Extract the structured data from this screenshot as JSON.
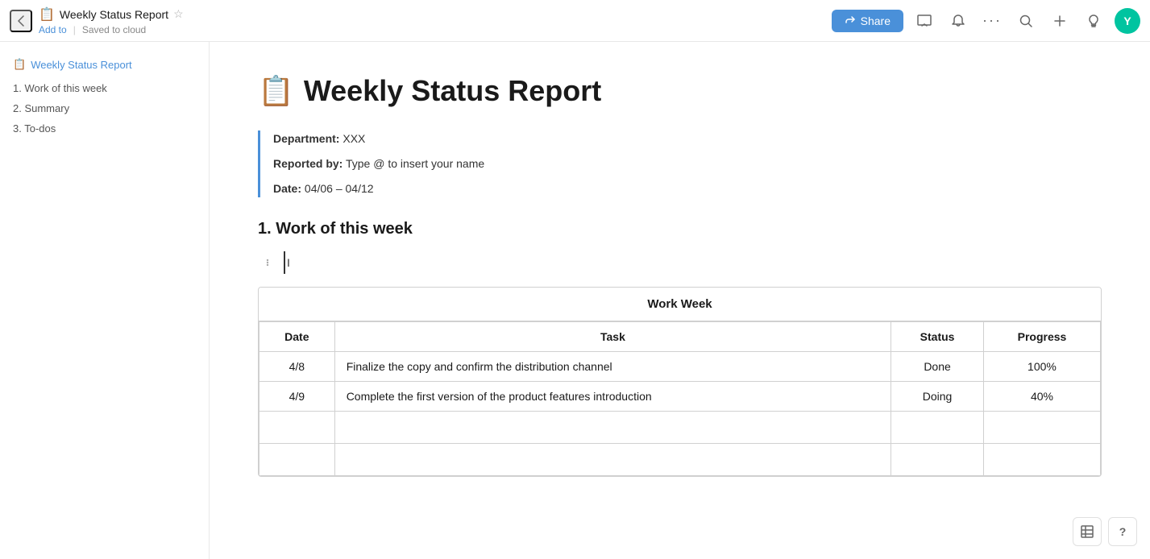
{
  "topbar": {
    "back_icon": "‹",
    "doc_icon": "📋",
    "doc_title": "Weekly Status Report",
    "star_icon": "☆",
    "add_to": "Add to",
    "separator": "|",
    "saved_status": "Saved to cloud",
    "share_label": "Share",
    "link_icon": "🔗",
    "present_icon": "⬜",
    "bell_icon": "🔔",
    "more_icon": "···",
    "search_icon": "🔍",
    "plus_icon": "+",
    "bulb_icon": "💡",
    "avatar_label": "Y"
  },
  "sidebar": {
    "doc_icon": "📋",
    "doc_link": "Weekly Status Report",
    "nav_items": [
      {
        "label": "1. Work of this week"
      },
      {
        "label": "2. Summary"
      },
      {
        "label": "3. To-dos"
      }
    ]
  },
  "main": {
    "heading_icon": "📋",
    "heading": "Weekly Status Report",
    "info": {
      "department_label": "Department:",
      "department_value": "XXX",
      "reported_by_label": "Reported by:",
      "reported_by_value": "Type @ to insert your name",
      "date_label": "Date:",
      "date_value": "04/06 – 04/12"
    },
    "section1_heading": "1. Work of this week",
    "table": {
      "title": "Work Week",
      "columns": [
        "Date",
        "Task",
        "Status",
        "Progress"
      ],
      "rows": [
        {
          "date": "4/8",
          "task": "Finalize the copy and confirm the distribution channel",
          "status": "Done",
          "progress": "100%"
        },
        {
          "date": "4/9",
          "task": "Complete the first version of the product features introduction",
          "status": "Doing",
          "progress": "40%"
        },
        {
          "date": "",
          "task": "",
          "status": "",
          "progress": ""
        },
        {
          "date": "",
          "task": "",
          "status": "",
          "progress": ""
        }
      ]
    }
  },
  "bottom_right": {
    "table_icon": "⊞",
    "help_icon": "?"
  }
}
